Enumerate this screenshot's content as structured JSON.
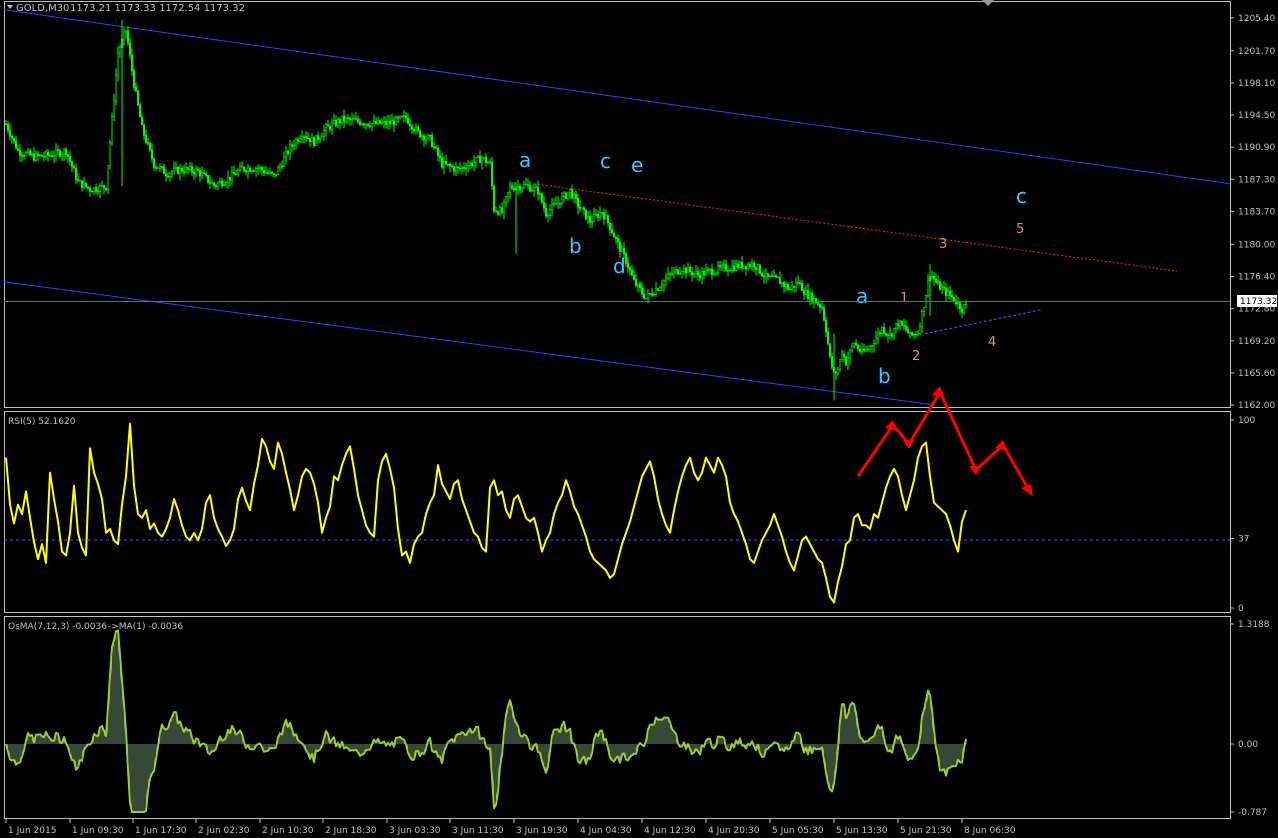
{
  "header": {
    "symbol_label": "GOLD,M30",
    "ohlc": "1173.21 1173.33 1172.54 1173.32"
  },
  "colors": {
    "background": "#000000",
    "frame": "#c0c0c0",
    "candle": "#00ff00",
    "channel": "#2f3fff",
    "red_line": "#ff2a00",
    "rsi_line": "#ffff00",
    "osma_line": "#9acd32",
    "wave_cyan": "#33ccff",
    "wave_gold": "#daa520",
    "arrow": "#ff0000"
  },
  "chart_data": [
    {
      "panel": "price",
      "type": "candlestick",
      "symbol": "GOLD",
      "timeframe": "M30",
      "ylim": [
        1162.0,
        1206.5
      ],
      "y_ticks": [
        "1205.40",
        "1201.70",
        "1198.10",
        "1194.50",
        "1190.90",
        "1187.30",
        "1183.70",
        "1180.00",
        "1176.40",
        "1172.80",
        "1169.20",
        "1165.60",
        "1162.00"
      ],
      "current_price": "1173.32",
      "x_ticks": [
        "1 Jun 2015",
        "1 Jun 09:30",
        "1 Jun 17:30",
        "2 Jun 02:30",
        "2 Jun 10:30",
        "2 Jun 18:30",
        "3 Jun 03:30",
        "3 Jun 11:30",
        "3 Jun 19:30",
        "4 Jun 04:30",
        "4 Jun 12:30",
        "4 Jun 20:30",
        "5 Jun 05:30",
        "5 Jun 13:30",
        "5 Jun 21:30",
        "8 Jun 06:30"
      ],
      "approx_close_path": [
        [
          0,
          1193.5
        ],
        [
          6,
          1190.5
        ],
        [
          14,
          1189.8
        ],
        [
          22,
          1190.0
        ],
        [
          30,
          1190.5
        ],
        [
          36,
          1187.0
        ],
        [
          42,
          1186.2
        ],
        [
          50,
          1186.5
        ],
        [
          56,
          1201.5
        ],
        [
          60,
          1204.0
        ],
        [
          64,
          1198.0
        ],
        [
          68,
          1193.0
        ],
        [
          74,
          1189.0
        ],
        [
          80,
          1188.0
        ],
        [
          88,
          1188.4
        ],
        [
          96,
          1188.2
        ],
        [
          104,
          1186.6
        ],
        [
          112,
          1187.5
        ],
        [
          118,
          1188.5
        ],
        [
          126,
          1188.6
        ],
        [
          134,
          1187.6
        ],
        [
          142,
          1190.8
        ],
        [
          148,
          1192.5
        ],
        [
          154,
          1191.5
        ],
        [
          160,
          1193.0
        ],
        [
          168,
          1194.0
        ],
        [
          176,
          1193.8
        ],
        [
          184,
          1193.5
        ],
        [
          192,
          1193.6
        ],
        [
          200,
          1194.2
        ],
        [
          206,
          1192.5
        ],
        [
          212,
          1191.8
        ],
        [
          218,
          1189.0
        ],
        [
          226,
          1188.4
        ],
        [
          232,
          1189.0
        ],
        [
          238,
          1189.7
        ],
        [
          242,
          1189.0
        ],
        [
          244,
          1184.0
        ],
        [
          248,
          1183.6
        ],
        [
          252,
          1186.4
        ],
        [
          260,
          1186.6
        ],
        [
          266,
          1186.0
        ],
        [
          270,
          1183.5
        ],
        [
          276,
          1184.7
        ],
        [
          282,
          1186.0
        ],
        [
          286,
          1184.4
        ],
        [
          292,
          1182.6
        ],
        [
          298,
          1183.7
        ],
        [
          302,
          1182.0
        ],
        [
          306,
          1180.0
        ],
        [
          310,
          1178.2
        ],
        [
          314,
          1175.8
        ],
        [
          320,
          1174.0
        ],
        [
          326,
          1175.2
        ],
        [
          332,
          1176.6
        ],
        [
          338,
          1177.3
        ],
        [
          346,
          1176.6
        ],
        [
          352,
          1177.0
        ],
        [
          358,
          1177.3
        ],
        [
          366,
          1177.6
        ],
        [
          374,
          1177.8
        ],
        [
          380,
          1176.3
        ],
        [
          386,
          1176.0
        ],
        [
          392,
          1175.0
        ],
        [
          396,
          1175.8
        ],
        [
          400,
          1174.5
        ],
        [
          404,
          1173.8
        ],
        [
          408,
          1173.0
        ],
        [
          410,
          1170.5
        ],
        [
          412,
          1167.2
        ],
        [
          414,
          1165.4
        ],
        [
          416,
          1166.0
        ],
        [
          418,
          1168.0
        ],
        [
          420,
          1166.8
        ],
        [
          424,
          1169.0
        ],
        [
          428,
          1167.8
        ],
        [
          432,
          1168.5
        ],
        [
          438,
          1170.6
        ],
        [
          442,
          1169.8
        ],
        [
          446,
          1171.2
        ],
        [
          450,
          1170.5
        ],
        [
          452,
          1169.7
        ],
        [
          456,
          1170.2
        ],
        [
          458,
          1172.2
        ],
        [
          460,
          1174.5
        ],
        [
          462,
          1176.8
        ],
        [
          466,
          1175.4
        ],
        [
          470,
          1174.6
        ],
        [
          474,
          1173.9
        ],
        [
          478,
          1172.8
        ],
        [
          480,
          1173.3
        ]
      ],
      "channel_lines": [
        {
          "from": [
            "1 Jun 2015",
            1206.3
          ],
          "to": [
            "right edge",
            1186.8
          ]
        },
        {
          "from": [
            "1 Jun 2015",
            1175.8
          ],
          "to": [
            "5 Jun 21:30",
            1162.0
          ]
        }
      ],
      "resistance_line": {
        "from": [
          "3 Jun 19:30",
          1186.8
        ],
        "to": [
          "8 Jun 06:30",
          1177.0
        ]
      },
      "support_line": {
        "from": [
          "5 Jun 21:30",
          1170.0
        ],
        "to": [
          "8 Jun 06:30",
          1172.7
        ]
      },
      "wave_labels_cyan": [
        "a",
        "b",
        "c",
        "d",
        "e",
        "a",
        "b",
        "c"
      ],
      "wave_labels_gold": [
        "1",
        "2",
        "3",
        "4",
        "5"
      ]
    },
    {
      "panel": "rsi",
      "type": "line",
      "title": "RSI(5) 52.1620",
      "ylim": [
        0,
        100
      ],
      "y_ticks": [
        "100",
        "37",
        "0"
      ],
      "level": 37,
      "approx_values": [
        [
          0,
          80
        ],
        [
          2,
          55
        ],
        [
          4,
          45
        ],
        [
          6,
          55
        ],
        [
          8,
          50
        ],
        [
          10,
          62
        ],
        [
          12,
          48
        ],
        [
          14,
          35
        ],
        [
          16,
          26
        ],
        [
          18,
          34
        ],
        [
          20,
          24
        ],
        [
          22,
          72
        ],
        [
          24,
          58
        ],
        [
          26,
          46
        ],
        [
          28,
          30
        ],
        [
          30,
          28
        ],
        [
          32,
          40
        ],
        [
          34,
          65
        ],
        [
          36,
          40
        ],
        [
          38,
          32
        ],
        [
          40,
          28
        ],
        [
          42,
          85
        ],
        [
          44,
          72
        ],
        [
          46,
          66
        ],
        [
          48,
          58
        ],
        [
          50,
          40
        ],
        [
          52,
          42
        ],
        [
          54,
          36
        ],
        [
          56,
          34
        ],
        [
          58,
          55
        ],
        [
          60,
          70
        ],
        [
          62,
          98
        ],
        [
          64,
          65
        ],
        [
          66,
          50
        ],
        [
          68,
          48
        ],
        [
          70,
          52
        ],
        [
          72,
          42
        ],
        [
          74,
          45
        ],
        [
          76,
          40
        ],
        [
          78,
          38
        ],
        [
          80,
          42
        ],
        [
          82,
          48
        ],
        [
          84,
          58
        ],
        [
          86,
          52
        ],
        [
          88,
          44
        ],
        [
          90,
          38
        ],
        [
          92,
          36
        ],
        [
          94,
          40
        ],
        [
          96,
          36
        ],
        [
          98,
          42
        ],
        [
          100,
          56
        ],
        [
          102,
          60
        ],
        [
          104,
          48
        ],
        [
          106,
          42
        ],
        [
          108,
          38
        ],
        [
          110,
          33
        ],
        [
          112,
          36
        ],
        [
          114,
          42
        ],
        [
          116,
          58
        ],
        [
          118,
          64
        ],
        [
          120,
          57
        ],
        [
          122,
          52
        ],
        [
          124,
          66
        ],
        [
          126,
          76
        ],
        [
          128,
          90
        ],
        [
          130,
          86
        ],
        [
          132,
          78
        ],
        [
          134,
          74
        ],
        [
          136,
          88
        ],
        [
          138,
          82
        ],
        [
          140,
          72
        ],
        [
          142,
          63
        ],
        [
          144,
          52
        ],
        [
          146,
          60
        ],
        [
          148,
          70
        ],
        [
          150,
          74
        ],
        [
          152,
          72
        ],
        [
          154,
          66
        ],
        [
          156,
          56
        ],
        [
          158,
          40
        ],
        [
          160,
          48
        ],
        [
          162,
          54
        ],
        [
          164,
          70
        ],
        [
          166,
          68
        ],
        [
          168,
          76
        ],
        [
          170,
          82
        ],
        [
          172,
          86
        ],
        [
          174,
          74
        ],
        [
          176,
          60
        ],
        [
          178,
          52
        ],
        [
          180,
          44
        ],
        [
          182,
          40
        ],
        [
          184,
          38
        ],
        [
          186,
          68
        ],
        [
          188,
          78
        ],
        [
          190,
          82
        ],
        [
          192,
          74
        ],
        [
          194,
          64
        ],
        [
          196,
          42
        ],
        [
          198,
          28
        ],
        [
          200,
          30
        ],
        [
          202,
          24
        ],
        [
          204,
          34
        ],
        [
          206,
          38
        ],
        [
          208,
          40
        ],
        [
          210,
          50
        ],
        [
          212,
          56
        ],
        [
          214,
          60
        ],
        [
          216,
          76
        ],
        [
          218,
          66
        ],
        [
          220,
          62
        ],
        [
          222,
          58
        ],
        [
          224,
          66
        ],
        [
          226,
          68
        ],
        [
          228,
          58
        ],
        [
          230,
          52
        ],
        [
          232,
          46
        ],
        [
          234,
          40
        ],
        [
          236,
          38
        ],
        [
          238,
          32
        ],
        [
          240,
          30
        ],
        [
          242,
          64
        ],
        [
          244,
          68
        ],
        [
          246,
          60
        ],
        [
          248,
          62
        ],
        [
          250,
          52
        ],
        [
          252,
          48
        ],
        [
          254,
          58
        ],
        [
          256,
          60
        ],
        [
          258,
          54
        ],
        [
          260,
          48
        ],
        [
          262,
          46
        ],
        [
          264,
          48
        ],
        [
          266,
          40
        ],
        [
          268,
          30
        ],
        [
          270,
          36
        ],
        [
          272,
          40
        ],
        [
          274,
          50
        ],
        [
          276,
          56
        ],
        [
          278,
          60
        ],
        [
          280,
          68
        ],
        [
          282,
          62
        ],
        [
          284,
          54
        ],
        [
          286,
          50
        ],
        [
          288,
          44
        ],
        [
          290,
          38
        ],
        [
          292,
          30
        ],
        [
          294,
          26
        ],
        [
          296,
          24
        ],
        [
          298,
          22
        ],
        [
          300,
          20
        ],
        [
          302,
          16
        ],
        [
          304,
          18
        ],
        [
          306,
          26
        ],
        [
          308,
          34
        ],
        [
          310,
          40
        ],
        [
          312,
          46
        ],
        [
          314,
          54
        ],
        [
          316,
          62
        ],
        [
          318,
          70
        ],
        [
          320,
          74
        ],
        [
          322,
          78
        ],
        [
          324,
          70
        ],
        [
          326,
          58
        ],
        [
          328,
          50
        ],
        [
          330,
          44
        ],
        [
          332,
          40
        ],
        [
          334,
          52
        ],
        [
          336,
          62
        ],
        [
          338,
          70
        ],
        [
          340,
          76
        ],
        [
          342,
          80
        ],
        [
          344,
          72
        ],
        [
          346,
          68
        ],
        [
          348,
          72
        ],
        [
          350,
          80
        ],
        [
          352,
          76
        ],
        [
          354,
          72
        ],
        [
          356,
          80
        ],
        [
          358,
          76
        ],
        [
          360,
          70
        ],
        [
          362,
          56
        ],
        [
          364,
          50
        ],
        [
          366,
          46
        ],
        [
          368,
          40
        ],
        [
          370,
          34
        ],
        [
          372,
          26
        ],
        [
          374,
          24
        ],
        [
          376,
          30
        ],
        [
          378,
          36
        ],
        [
          380,
          40
        ],
        [
          382,
          44
        ],
        [
          384,
          50
        ],
        [
          386,
          44
        ],
        [
          388,
          38
        ],
        [
          390,
          30
        ],
        [
          392,
          24
        ],
        [
          394,
          20
        ],
        [
          396,
          28
        ],
        [
          398,
          36
        ],
        [
          400,
          38
        ],
        [
          402,
          34
        ],
        [
          404,
          30
        ],
        [
          406,
          26
        ],
        [
          408,
          24
        ],
        [
          410,
          16
        ],
        [
          412,
          6
        ],
        [
          414,
          3
        ],
        [
          416,
          14
        ],
        [
          418,
          22
        ],
        [
          420,
          34
        ],
        [
          422,
          36
        ],
        [
          424,
          48
        ],
        [
          426,
          50
        ],
        [
          428,
          44
        ],
        [
          430,
          44
        ],
        [
          432,
          42
        ],
        [
          434,
          50
        ],
        [
          436,
          48
        ],
        [
          438,
          56
        ],
        [
          440,
          64
        ],
        [
          442,
          70
        ],
        [
          444,
          74
        ],
        [
          446,
          70
        ],
        [
          448,
          60
        ],
        [
          450,
          52
        ],
        [
          452,
          60
        ],
        [
          454,
          68
        ],
        [
          456,
          80
        ],
        [
          458,
          86
        ],
        [
          460,
          88
        ],
        [
          462,
          70
        ],
        [
          464,
          56
        ],
        [
          466,
          54
        ],
        [
          468,
          52
        ],
        [
          470,
          50
        ],
        [
          472,
          44
        ],
        [
          474,
          36
        ],
        [
          476,
          30
        ],
        [
          478,
          46
        ],
        [
          480,
          52
        ]
      ]
    },
    {
      "panel": "osma",
      "type": "histogram+line",
      "title": "OsMA(7,12,3) -0.0036",
      "overlay_title": "->MA(1) -0.0036",
      "ylim": [
        -0.787,
        1.3188
      ],
      "y_ticks": [
        "1.3188",
        "0.00",
        "-0.787"
      ]
    }
  ],
  "annotations": {
    "red_arrow_path_rsi_panel": "zigzag up then down (projected wave)"
  }
}
